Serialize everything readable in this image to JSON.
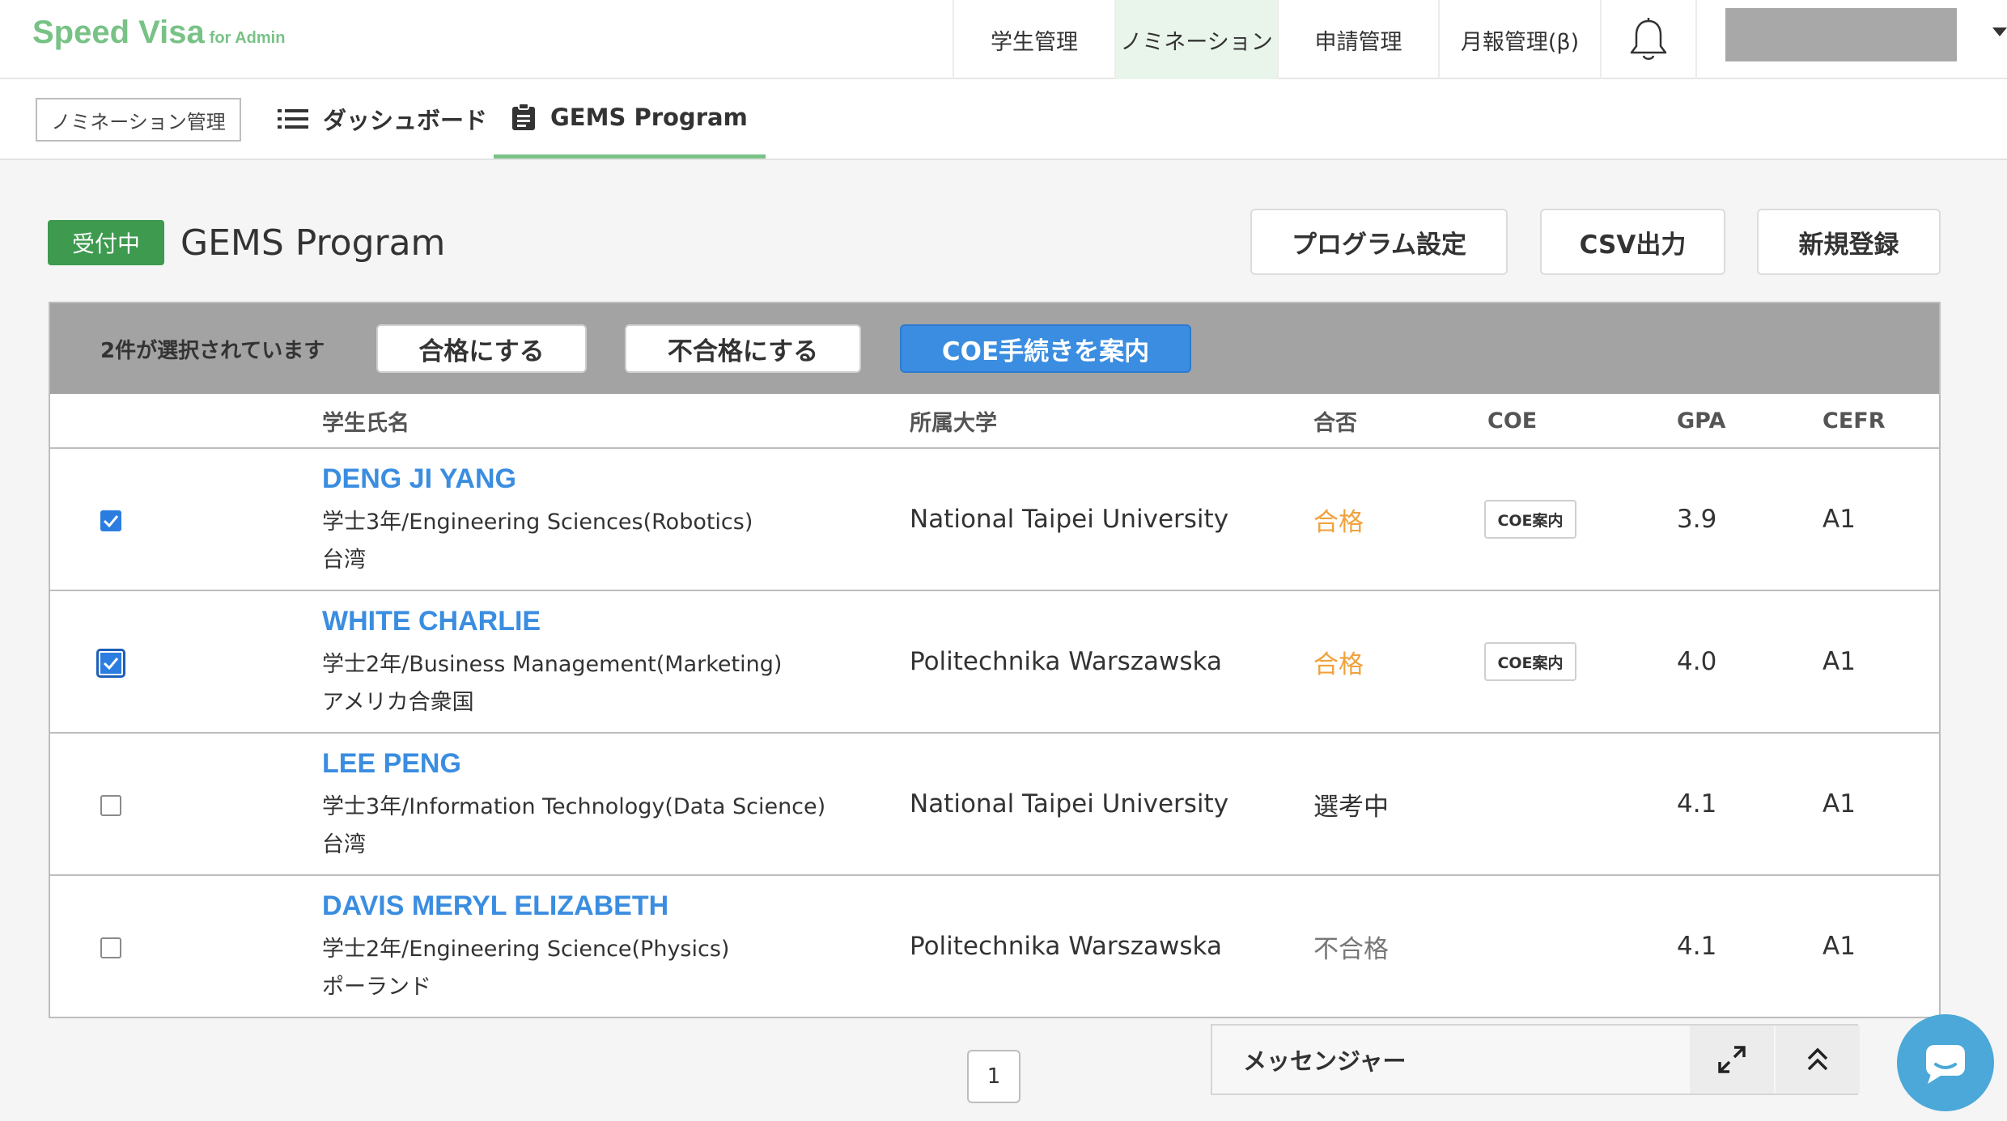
{
  "header": {
    "brand": "Speed Visa",
    "brand_suffix": "for Admin",
    "nav": [
      {
        "label": "学生管理",
        "active": false
      },
      {
        "label": "ノミネーション",
        "active": true
      },
      {
        "label": "申請管理",
        "active": false
      },
      {
        "label": "月報管理(β)",
        "active": false
      }
    ],
    "bell_icon": "bell-icon"
  },
  "subnav": {
    "section_label": "ノミネーション管理",
    "tabs": [
      {
        "label": "ダッシュボード",
        "icon": "list-icon"
      },
      {
        "label": "GEMS Program",
        "icon": "clipboard-icon",
        "active": true
      }
    ]
  },
  "page": {
    "status_badge": "受付中",
    "title": "GEMS Program",
    "buttons": {
      "program_settings": "プログラム設定",
      "csv_export": "CSV出力",
      "new_register": "新規登録"
    }
  },
  "bulk": {
    "selected_text": "2件が選択されています",
    "pass_button": "合格にする",
    "fail_button": "不合格にする",
    "coe_button": "COE手続きを案内"
  },
  "table": {
    "columns": {
      "name": "学生氏名",
      "university": "所属大学",
      "result": "合否",
      "coe": "COE",
      "gpa": "GPA",
      "cefr": "CEFR"
    },
    "rows": [
      {
        "checked": true,
        "name": "DENG JI YANG",
        "course": "学士3年/Engineering Sciences(Robotics)",
        "country": "台湾",
        "university": "National Taipei University",
        "result": "合格",
        "coe": "COE案内",
        "gpa": "3.9",
        "cefr": "A1"
      },
      {
        "checked": true,
        "name": "WHITE CHARLIE",
        "course": "学士2年/Business Management(Marketing)",
        "country": "アメリカ合衆国",
        "university": "Politechnika Warszawska",
        "result": "合格",
        "coe": "COE案内",
        "gpa": "4.0",
        "cefr": "A1"
      },
      {
        "checked": false,
        "name": "LEE PENG",
        "course": "学士3年/Information Technology(Data Science)",
        "country": "台湾",
        "university": "National Taipei University",
        "result": "選考中",
        "coe": "",
        "gpa": "4.1",
        "cefr": "A1"
      },
      {
        "checked": false,
        "name": "DAVIS MERYL ELIZABETH",
        "course": "学士2年/Engineering Science(Physics)",
        "country": "ポーランド",
        "university": "Politechnika Warszawska",
        "result": "不合格",
        "coe": "",
        "gpa": "4.1",
        "cefr": "A1"
      }
    ]
  },
  "pagination": {
    "current": "1"
  },
  "messenger": {
    "label": "メッセンジャー",
    "expand_icon": "expand-icon",
    "collapse_icon": "double-chevron-up-icon"
  },
  "colors": {
    "brand": "#78c286",
    "status_badge": "#3d9a4f",
    "link": "#3a8de0",
    "pass": "#f0a23c",
    "bulk_bar": "#a3a3a3",
    "primary_button": "#3a8de0",
    "chat": "#4ba8d8"
  }
}
